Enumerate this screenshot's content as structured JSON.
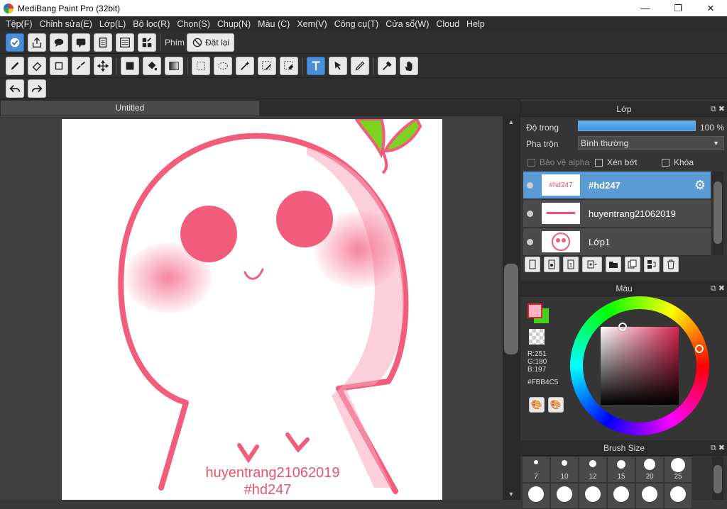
{
  "window": {
    "title": "MediBang Paint Pro (32bit)",
    "minimize": "—",
    "maximize": "❐",
    "close": "✕"
  },
  "menu": [
    "Tệp(F)",
    "Chỉnh sửa(E)",
    "Lớp(L)",
    "Bộ lọc(R)",
    "Chọn(S)",
    "Chụp(N)",
    "Màu (C)",
    "Xem(V)",
    "Công cụ(T)",
    "Cửa sổ(W)",
    "Cloud",
    "Help"
  ],
  "toolbar1": {
    "phim_label": "Phím",
    "reset_label": "Đặt lại"
  },
  "document": {
    "tab_title": "Untitled",
    "canvas_text_1": "huyentrang21062019",
    "canvas_text_2": "#hd247"
  },
  "layer_panel": {
    "title": "Lớp",
    "opacity_label": "Độ trong",
    "opacity_value": "100 %",
    "opacity_fraction": 1.0,
    "blend_label": "Pha trộn",
    "blend_value": "Bình thường",
    "protect_alpha": "Bảo vệ alpha",
    "clipping": "Xén bớt",
    "lock": "Khóa",
    "layers": [
      {
        "name": "#hd247",
        "thumb_text": "#hd247",
        "selected": true
      },
      {
        "name": "huyentrang21062019",
        "thumb_text": "",
        "selected": false
      },
      {
        "name": "Lớp1",
        "thumb_text": "",
        "selected": false
      }
    ]
  },
  "color_panel": {
    "title": "Màu",
    "r": "R:251",
    "g": "G:180",
    "b": "B:197",
    "hex": "#FBB4C5",
    "fg_color": "#FBB4C5",
    "bg_color": "#44D31E"
  },
  "brush_panel": {
    "title": "Brush Size",
    "sizes": [
      "7",
      "10",
      "12",
      "15",
      "20",
      "25"
    ]
  },
  "colors": {
    "accent": "#5b9bd5",
    "stroke": "#f25d7e"
  }
}
